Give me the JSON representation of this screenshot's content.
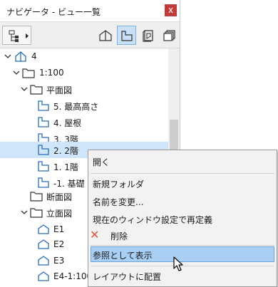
{
  "window": {
    "title": "ナビゲータ - ビュー一覧",
    "close_label": "x"
  },
  "toolbar": {
    "buttons": [
      {
        "icon": "project-map-icon"
      },
      {
        "icon": "view-map-icon"
      },
      {
        "icon": "layout-book-icon"
      },
      {
        "icon": "publisher-sets-icon"
      }
    ],
    "active_view": "view-map"
  },
  "tree": {
    "root": {
      "label": "4"
    },
    "set": {
      "label": "1:100"
    },
    "floor_plans": {
      "label": "平面図",
      "items": [
        {
          "label": "5. 最高高さ"
        },
        {
          "label": "4. 屋根"
        },
        {
          "label": "3. 3階"
        },
        {
          "label": "2. 2階"
        },
        {
          "label": "1. 1階"
        },
        {
          "label": "-1. 基礎"
        }
      ],
      "selected_index": 3
    },
    "sections": {
      "label": "断面図"
    },
    "elevations": {
      "label": "立面図",
      "items": [
        {
          "label": "E1"
        },
        {
          "label": "E2"
        },
        {
          "label": "E3"
        },
        {
          "label": "E4-1:100"
        }
      ]
    }
  },
  "context_menu": {
    "items": [
      {
        "label": "開く"
      },
      {
        "label": "新規フォルダ"
      },
      {
        "label": "名前を変更..."
      },
      {
        "label": "現在のウィンドウ設定で再定義"
      },
      {
        "label": "削除",
        "icon": "delete-x-icon"
      },
      {
        "label": "参照として表示"
      },
      {
        "label": "レイアウトに配置"
      }
    ],
    "highlighted_index": 5
  },
  "colors": {
    "accent": "#c03b3b",
    "selection": "#cfe5fa",
    "menu_highlight": "#a9cff4",
    "tree_icon": "#2a6db5"
  }
}
